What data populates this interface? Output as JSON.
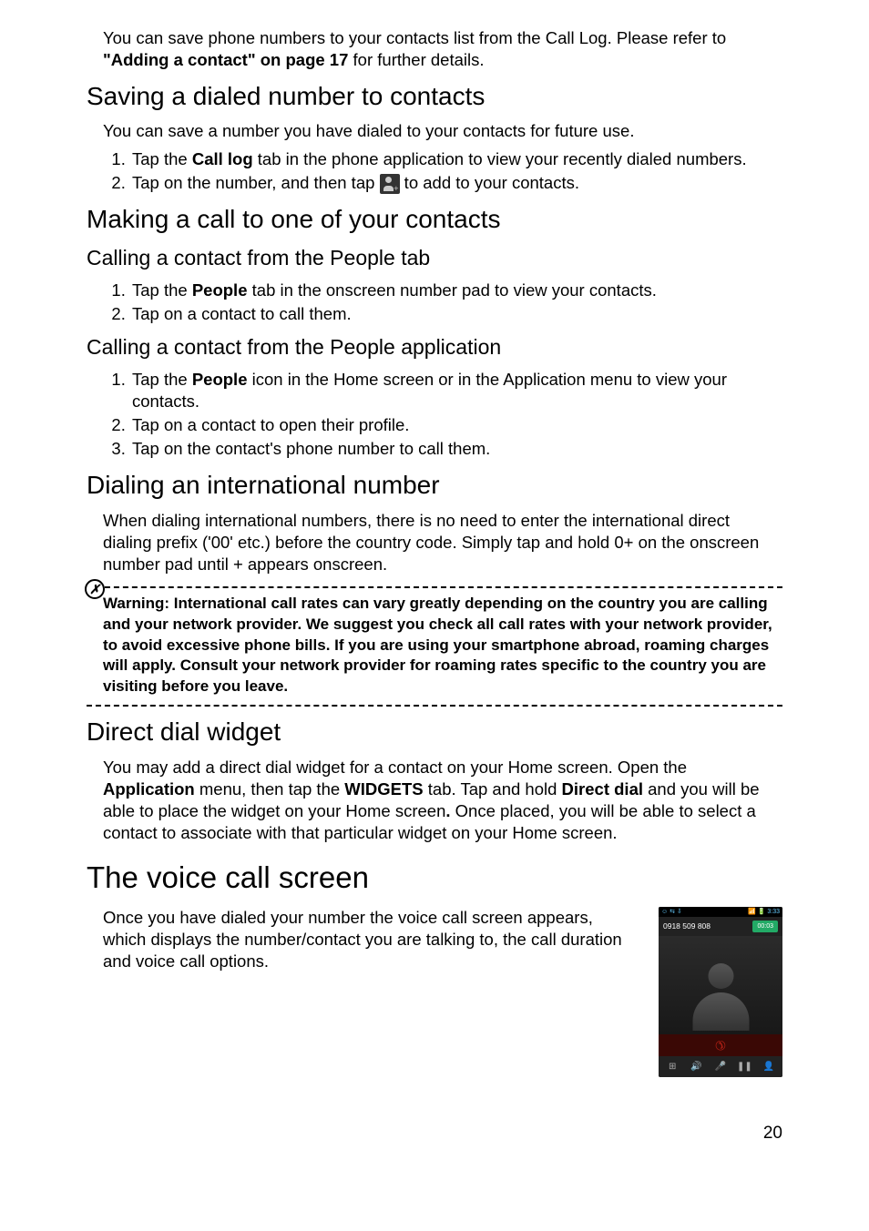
{
  "intro": {
    "text_a": "You can save phone numbers to your contacts list from the Call Log. Please refer to ",
    "bold": "\"Adding a contact\" on page 17",
    "text_b": " for further details."
  },
  "saving": {
    "heading": "Saving a dialed number to contacts",
    "body": "You can save a number you have dialed to your contacts for future use.",
    "step1_a": "Tap the ",
    "step1_bold": "Call log",
    "step1_b": " tab in the phone application to view your recently dialed numbers.",
    "step2_a": "Tap on the number, and then tap ",
    "step2_b": " to add to your contacts."
  },
  "making_call": {
    "heading": "Making a call to one of your contacts",
    "sub1_heading": "Calling a contact from the People tab",
    "sub1_step1_a": "Tap the ",
    "sub1_step1_bold": "People",
    "sub1_step1_b": " tab in the onscreen number pad to view your contacts.",
    "sub1_step2": "Tap on a contact to call them.",
    "sub2_heading": "Calling a contact from the People application",
    "sub2_step1_a": "Tap the ",
    "sub2_step1_bold": "People",
    "sub2_step1_b": " icon in the Home screen or in the Application menu to view your contacts.",
    "sub2_step2": "Tap on a contact to open their profile.",
    "sub2_step3": "Tap on the contact's phone number to call them."
  },
  "international": {
    "heading": "Dialing an international number",
    "body": "When dialing international numbers, there is no need to enter the international direct dialing prefix ('00' etc.) before the country code. Simply tap and hold 0+ on the onscreen number pad until + appears onscreen.",
    "warning": "Warning: International call rates can vary greatly depending on the country you are calling and your network provider. We suggest you check all call rates with your network provider, to avoid excessive phone bills. If you are using your smartphone abroad, roaming charges will apply. Consult your network provider for roaming rates specific to the country you are visiting before you leave."
  },
  "direct_dial": {
    "heading": "Direct dial widget",
    "body_a": "You may add a direct dial widget for a contact on your Home screen. Open the ",
    "bold1": "Application",
    "body_b": " menu, then tap the ",
    "bold2": "WIDGETS",
    "body_c": " tab. Tap and hold ",
    "bold3": "Direct dial",
    "body_d": " and you will be able to place the widget on your Home screen",
    "bold_period": ".",
    "body_e": " Once placed, you will be able to select a contact to associate with that particular widget on your Home screen."
  },
  "voice_call": {
    "heading": "The voice call screen",
    "body": "Once you have dialed your number the voice call screen appears, which displays the number/contact you are talking to, the call duration and voice call options."
  },
  "phone": {
    "status_left": "☺ ⇆ ⇩",
    "status_right": "📶 🔋 3:33",
    "number": "0918 509 808",
    "duration": "00:03"
  },
  "page_number": "20"
}
